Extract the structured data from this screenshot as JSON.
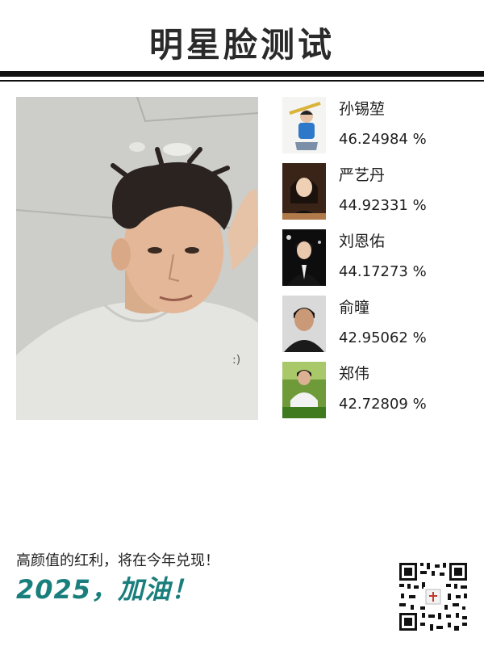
{
  "header": {
    "title": "明星脸测试"
  },
  "matches": [
    {
      "name": "孙锡堃",
      "score": "46.24984 %"
    },
    {
      "name": "严艺丹",
      "score": "44.92331 %"
    },
    {
      "name": "刘恩佑",
      "score": "44.17273 %"
    },
    {
      "name": "俞曈",
      "score": "42.95062 %"
    },
    {
      "name": "郑伟",
      "score": "42.72809 %"
    }
  ],
  "footer": {
    "slogan": "高颜值的红利，将在今年兑现！",
    "cheer": "2025，加油！"
  },
  "colors": {
    "accent": "#1a7f7c",
    "rule": "#111111",
    "title": "#2a2a2a"
  },
  "icons": [
    "user-photo",
    "celebrity-thumbnail",
    "qr-code"
  ]
}
